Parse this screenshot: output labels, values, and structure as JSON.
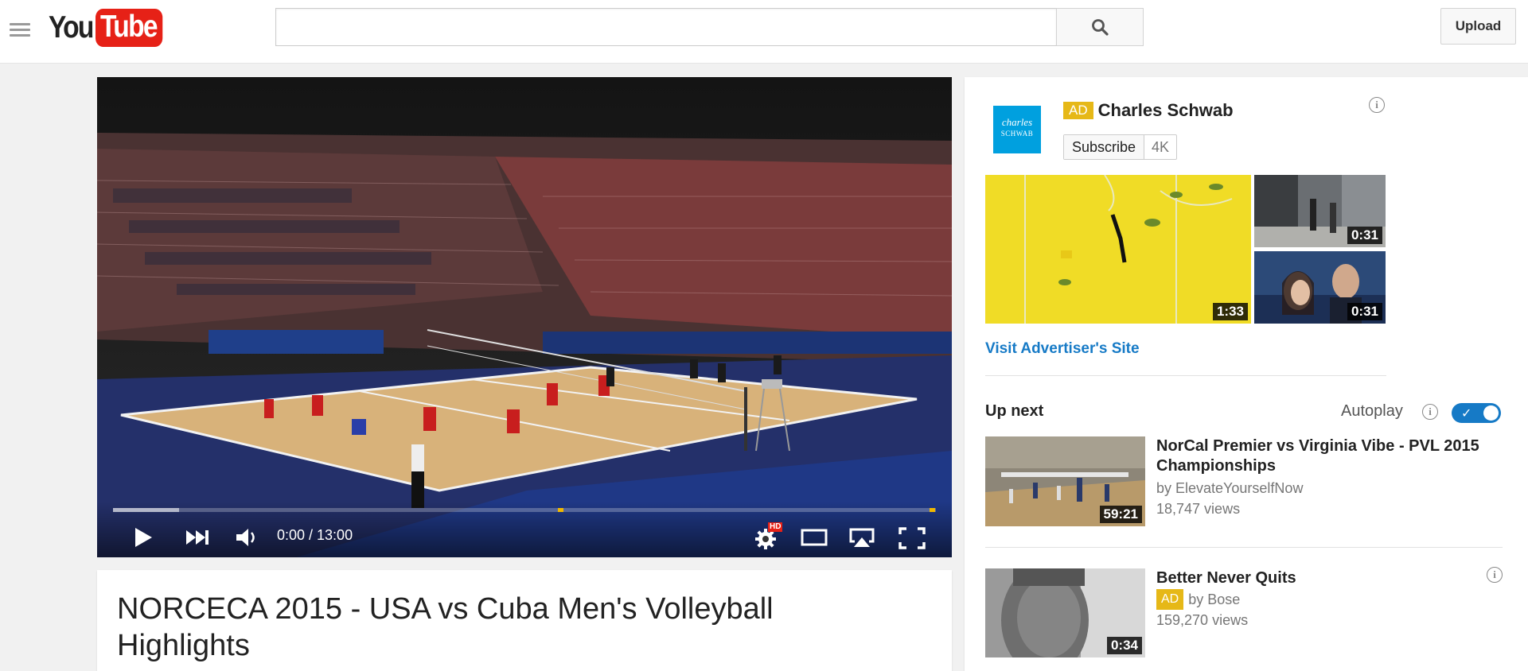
{
  "masthead": {
    "logo_you": "You",
    "logo_tube": "Tube",
    "search_value": "",
    "upload_label": "Upload"
  },
  "player": {
    "time_label": "0:00 / 13:00",
    "current_time": "0:00",
    "duration": "13:00",
    "hd_badge": "HD",
    "progress_loaded_fraction": 0.08
  },
  "video": {
    "title": "NORCECA 2015 - USA vs Cuba Men's Volleyball Highlights"
  },
  "ad": {
    "badge": "AD",
    "advertiser": "Charles Schwab",
    "logo_text_line1": "charles",
    "logo_text_line2": "SCHWAB",
    "subscribe_label": "Subscribe",
    "subscriber_count": "4K",
    "thumb_durations": [
      "1:33",
      "0:31",
      "0:31"
    ],
    "visit_link": "Visit Advertiser's Site"
  },
  "upnext": {
    "heading": "Up next",
    "autoplay_label": "Autoplay",
    "autoplay_on": true
  },
  "recommendations": [
    {
      "title": "NorCal Premier vs Virginia Vibe - PVL 2015 Championships",
      "channel": "by ElevateYourselfNow",
      "views": "18,747 views",
      "duration": "59:21"
    },
    {
      "title": "Better Never Quits",
      "ad_badge": "AD",
      "channel": "by Bose",
      "views": "159,270 views",
      "duration": "0:34"
    }
  ],
  "colors": {
    "brand_red": "#e62117",
    "link_blue": "#167ac6",
    "ad_yellow": "#e6b817",
    "progress_marker": "#f0b800"
  }
}
